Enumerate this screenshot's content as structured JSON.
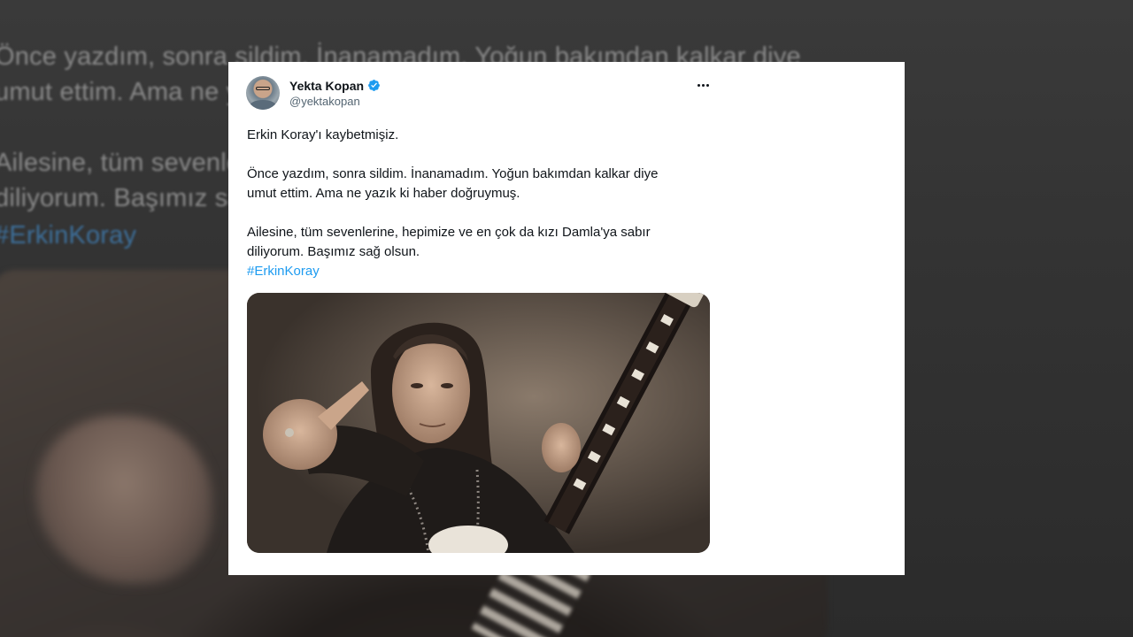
{
  "background": {
    "line1": "Önce yazdım, sonra sildim. İnanamadım. Yoğun bakımdan kalkar diye",
    "line2": "umut ettim. Ama ne y",
    "line3": "Ailesine, tüm sevenle",
    "line4": "diliyorum. Başımız sa",
    "line5": "#ErkinKoray"
  },
  "tweet": {
    "author": {
      "display_name": "Yekta Kopan",
      "handle": "@yektakopan",
      "verified": true
    },
    "paragraphs": [
      "Erkin Koray'ı kaybetmişiz.",
      "Önce yazdım, sonra sildim. İnanamadım. Yoğun bakımdan kalkar diye",
      "umut ettim. Ama ne yazık ki haber doğruymuş.",
      "Ailesine, tüm sevenlerine, hepimize ve en çok da kızı Damla'ya sabır",
      "diliyorum. Başımız sağ olsun."
    ],
    "hashtag": "#ErkinKoray",
    "icons": {
      "verified": "verified-badge-icon",
      "more": "more-options-icon"
    },
    "colors": {
      "link": "#1d9bf0",
      "text": "#0f1419",
      "muted": "#536471"
    }
  }
}
